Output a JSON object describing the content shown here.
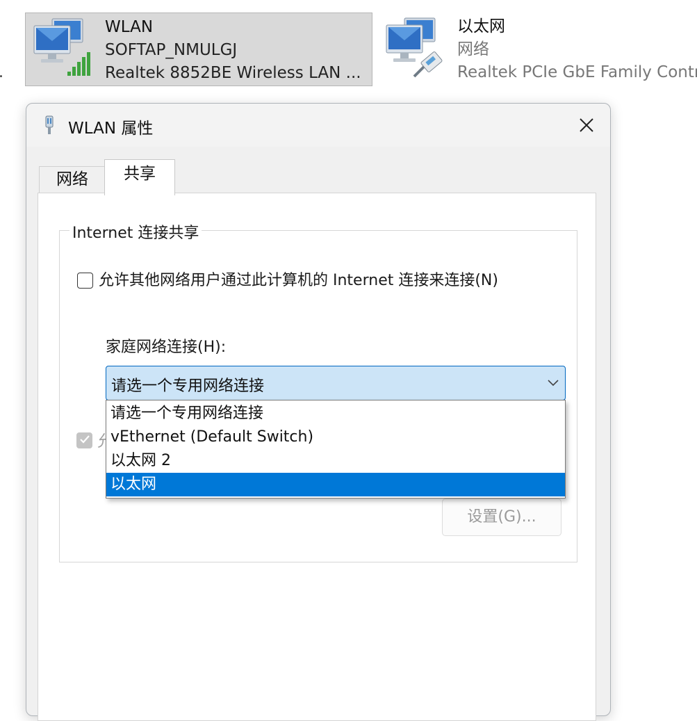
{
  "connections": [
    {
      "name": "WLAN",
      "status": "SOFTAP_NMULGJ",
      "device": "Realtek 8852BE Wireless LAN ...",
      "icon": "wifi-network-icon",
      "selected": true
    },
    {
      "name": "以太网",
      "status": "网络",
      "device": "Realtek PCIe GbE Family Contr",
      "icon": "ethernet-network-icon",
      "selected": false
    }
  ],
  "left_truncation": ".",
  "dialog": {
    "title": "WLAN 属性",
    "icon": "network-adapter-icon",
    "tabs": [
      {
        "label": "网络",
        "active": false
      },
      {
        "label": "共享",
        "active": true
      }
    ],
    "group_title": "Internet 连接共享",
    "allow_sharing_label": "允许其他网络用户通过此计算机的 Internet 连接来连接(N)",
    "allow_sharing_checked": false,
    "home_connection_label": "家庭网络连接(H):",
    "home_connection_selected": "请选一个专用网络连接",
    "home_connection_options": [
      "请选一个专用网络连接",
      "vEthernet (Default Switch)",
      "以太网 2",
      "以太网"
    ],
    "highlighted_option": "以太网",
    "disabled_check_label_fragment": "允",
    "disabled_checked": true,
    "settings_button": "设置(G)..."
  },
  "colors": {
    "accent": "#0078d7",
    "combo_bg": "#cce4f7",
    "selected_item_bg": "#d9d9d9",
    "disabled_text": "#a0a0a0"
  }
}
